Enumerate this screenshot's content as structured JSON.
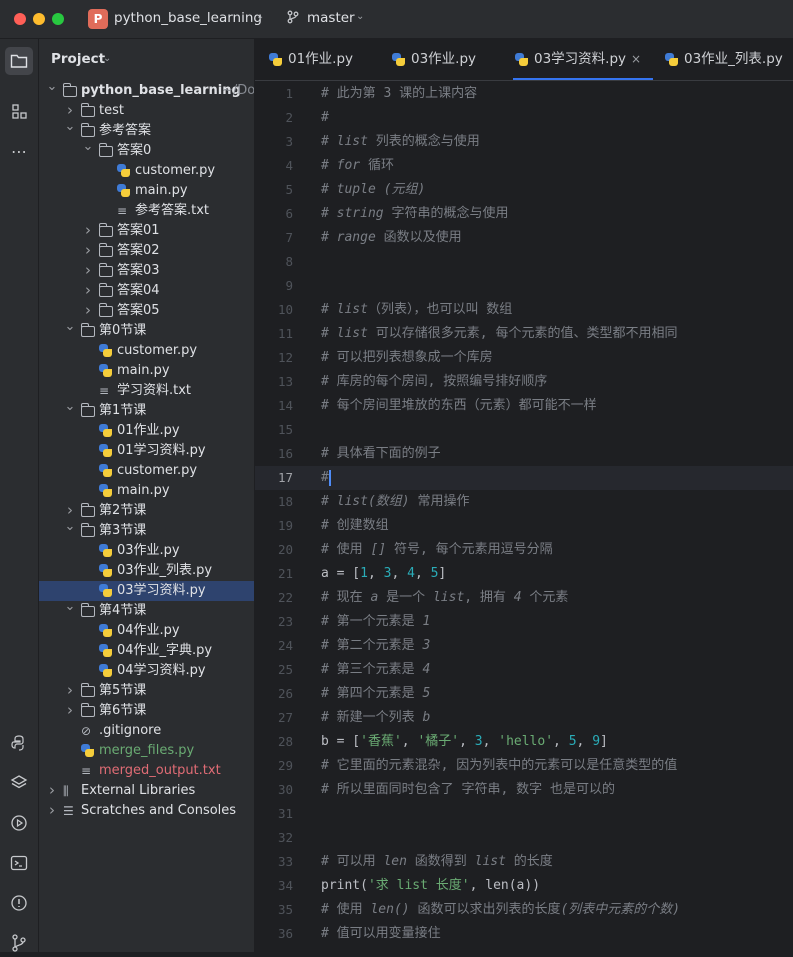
{
  "window": {
    "project_badge": "P",
    "project_name": "python_base_learning",
    "branch_name": "master"
  },
  "project_panel": {
    "title": "Project",
    "tree": [
      {
        "label": "python_base_learning",
        "suffix": " ~/Do",
        "type": "folder",
        "depth": 0,
        "expanded": true,
        "bold": true
      },
      {
        "label": "test",
        "type": "folder",
        "depth": 1,
        "expanded": false
      },
      {
        "label": "参考答案",
        "type": "folder",
        "depth": 1,
        "expanded": true
      },
      {
        "label": "答案0",
        "type": "folder",
        "depth": 2,
        "expanded": true
      },
      {
        "label": "customer.py",
        "type": "py",
        "depth": 3
      },
      {
        "label": "main.py",
        "type": "py",
        "depth": 3
      },
      {
        "label": "参考答案.txt",
        "type": "txt",
        "depth": 3
      },
      {
        "label": "答案01",
        "type": "folder",
        "depth": 2,
        "expanded": false
      },
      {
        "label": "答案02",
        "type": "folder",
        "depth": 2,
        "expanded": false
      },
      {
        "label": "答案03",
        "type": "folder",
        "depth": 2,
        "expanded": false
      },
      {
        "label": "答案04",
        "type": "folder",
        "depth": 2,
        "expanded": false
      },
      {
        "label": "答案05",
        "type": "folder",
        "depth": 2,
        "expanded": false
      },
      {
        "label": "第0节课",
        "type": "folder",
        "depth": 1,
        "expanded": true
      },
      {
        "label": "customer.py",
        "type": "py",
        "depth": 2
      },
      {
        "label": "main.py",
        "type": "py",
        "depth": 2
      },
      {
        "label": "学习资料.txt",
        "type": "txt",
        "depth": 2
      },
      {
        "label": "第1节课",
        "type": "folder",
        "depth": 1,
        "expanded": true
      },
      {
        "label": "01作业.py",
        "type": "py",
        "depth": 2
      },
      {
        "label": "01学习资料.py",
        "type": "py",
        "depth": 2
      },
      {
        "label": "customer.py",
        "type": "py",
        "depth": 2
      },
      {
        "label": "main.py",
        "type": "py",
        "depth": 2
      },
      {
        "label": "第2节课",
        "type": "folder",
        "depth": 1,
        "expanded": false
      },
      {
        "label": "第3节课",
        "type": "folder",
        "depth": 1,
        "expanded": true
      },
      {
        "label": "03作业.py",
        "type": "py",
        "depth": 2
      },
      {
        "label": "03作业_列表.py",
        "type": "py",
        "depth": 2
      },
      {
        "label": "03学习资料.py",
        "type": "py",
        "depth": 2,
        "selected": true
      },
      {
        "label": "第4节课",
        "type": "folder",
        "depth": 1,
        "expanded": true
      },
      {
        "label": "04作业.py",
        "type": "py",
        "depth": 2
      },
      {
        "label": "04作业_字典.py",
        "type": "py",
        "depth": 2
      },
      {
        "label": "04学习资料.py",
        "type": "py",
        "depth": 2
      },
      {
        "label": "第5节课",
        "type": "folder",
        "depth": 1,
        "expanded": false
      },
      {
        "label": "第6节课",
        "type": "folder",
        "depth": 1,
        "expanded": false
      },
      {
        "label": ".gitignore",
        "type": "git",
        "depth": 1
      },
      {
        "label": "merge_files.py",
        "type": "py",
        "depth": 1,
        "color": "green"
      },
      {
        "label": "merged_output.txt",
        "type": "txt",
        "depth": 1,
        "color": "red"
      },
      {
        "label": "External Libraries",
        "type": "lib",
        "depth": 0,
        "expanded": false
      },
      {
        "label": "Scratches and Consoles",
        "type": "scratch",
        "depth": 0,
        "expanded": false
      }
    ]
  },
  "tabs": [
    {
      "label": "01作业.py",
      "active": false
    },
    {
      "label": "03作业.py",
      "active": false
    },
    {
      "label": "03学习资料.py",
      "active": true,
      "close": "×"
    },
    {
      "label": "03作业_列表.py",
      "active": false
    }
  ],
  "editor": {
    "current_line": 17,
    "lines": [
      {
        "n": "1",
        "segs": [
          [
            "cm",
            "# 此为第 3 课的上课内容"
          ]
        ]
      },
      {
        "n": "2",
        "segs": [
          [
            "cm",
            "#"
          ]
        ]
      },
      {
        "n": "3",
        "segs": [
          [
            "cm",
            "# "
          ],
          [
            "cmi",
            "list"
          ],
          [
            "cm",
            " 列表的概念与使用"
          ]
        ]
      },
      {
        "n": "4",
        "segs": [
          [
            "cm",
            "# "
          ],
          [
            "cmi",
            "for"
          ],
          [
            "cm",
            " 循环"
          ]
        ]
      },
      {
        "n": "5",
        "segs": [
          [
            "cm",
            "# "
          ],
          [
            "cmi",
            "tuple (元组)"
          ]
        ]
      },
      {
        "n": "6",
        "segs": [
          [
            "cm",
            "# "
          ],
          [
            "cmi",
            "string"
          ],
          [
            "cm",
            " 字符串的概念与使用"
          ]
        ]
      },
      {
        "n": "7",
        "segs": [
          [
            "cm",
            "# "
          ],
          [
            "cmi",
            "range"
          ],
          [
            "cm",
            " 函数以及使用"
          ]
        ]
      },
      {
        "n": "8",
        "segs": []
      },
      {
        "n": "9",
        "segs": []
      },
      {
        "n": "10",
        "segs": [
          [
            "cm",
            "# "
          ],
          [
            "cmi",
            "list"
          ],
          [
            "cm",
            "（列表），也可以叫 数组"
          ]
        ]
      },
      {
        "n": "11",
        "segs": [
          [
            "cm",
            "# "
          ],
          [
            "cmi",
            "list"
          ],
          [
            "cm",
            " 可以存储很多元素, 每个元素的值、类型都不用相同"
          ]
        ]
      },
      {
        "n": "12",
        "segs": [
          [
            "cm",
            "# 可以把列表想象成一个库房"
          ]
        ]
      },
      {
        "n": "13",
        "segs": [
          [
            "cm",
            "# 库房的每个房间, 按照编号排好顺序"
          ]
        ]
      },
      {
        "n": "14",
        "segs": [
          [
            "cm",
            "# 每个房间里堆放的东西（元素）都可能不一样"
          ]
        ]
      },
      {
        "n": "15",
        "segs": []
      },
      {
        "n": "16",
        "segs": [
          [
            "cm",
            "# 具体看下面的例子"
          ]
        ]
      },
      {
        "n": "17",
        "segs": [
          [
            "cm",
            "#"
          ],
          [
            "caret",
            ""
          ]
        ]
      },
      {
        "n": "18",
        "segs": [
          [
            "cm",
            "# "
          ],
          [
            "cmi",
            "list(数组)"
          ],
          [
            "cm",
            " 常用操作"
          ]
        ]
      },
      {
        "n": "19",
        "segs": [
          [
            "cm",
            "# 创建数组"
          ]
        ]
      },
      {
        "n": "20",
        "segs": [
          [
            "cm",
            "# 使用 "
          ],
          [
            "cmi",
            "[]"
          ],
          [
            "cm",
            " 符号, 每个元素用逗号分隔"
          ]
        ]
      },
      {
        "n": "21",
        "segs": [
          [
            "txt",
            "a = ["
          ],
          [
            "num",
            "1"
          ],
          [
            "txt",
            ", "
          ],
          [
            "num",
            "3"
          ],
          [
            "txt",
            ", "
          ],
          [
            "num",
            "4"
          ],
          [
            "txt",
            ", "
          ],
          [
            "num",
            "5"
          ],
          [
            "txt",
            "]"
          ]
        ]
      },
      {
        "n": "22",
        "segs": [
          [
            "cm",
            "# 现在 "
          ],
          [
            "cmi",
            "a"
          ],
          [
            "cm",
            " 是一个 "
          ],
          [
            "cmi",
            "list"
          ],
          [
            "cm",
            ", 拥有 "
          ],
          [
            "cmi",
            "4"
          ],
          [
            "cm",
            " 个元素"
          ]
        ]
      },
      {
        "n": "23",
        "segs": [
          [
            "cm",
            "# 第一个元素是 "
          ],
          [
            "cmi",
            "1"
          ]
        ]
      },
      {
        "n": "24",
        "segs": [
          [
            "cm",
            "# 第二个元素是 "
          ],
          [
            "cmi",
            "3"
          ]
        ]
      },
      {
        "n": "25",
        "segs": [
          [
            "cm",
            "# 第三个元素是 "
          ],
          [
            "cmi",
            "4"
          ]
        ]
      },
      {
        "n": "26",
        "segs": [
          [
            "cm",
            "# 第四个元素是 "
          ],
          [
            "cmi",
            "5"
          ]
        ]
      },
      {
        "n": "27",
        "segs": [
          [
            "cm",
            "# 新建一个列表 "
          ],
          [
            "cmi",
            "b"
          ]
        ]
      },
      {
        "n": "28",
        "segs": [
          [
            "txt",
            "b = ["
          ],
          [
            "str",
            "'香蕉'"
          ],
          [
            "txt",
            ", "
          ],
          [
            "str",
            "'橘子'"
          ],
          [
            "txt",
            ", "
          ],
          [
            "num",
            "3"
          ],
          [
            "txt",
            ", "
          ],
          [
            "str",
            "'hello'"
          ],
          [
            "txt",
            ", "
          ],
          [
            "num",
            "5"
          ],
          [
            "txt",
            ", "
          ],
          [
            "num",
            "9"
          ],
          [
            "txt",
            "]"
          ]
        ]
      },
      {
        "n": "29",
        "segs": [
          [
            "cm",
            "# 它里面的元素混杂, 因为列表中的元素可以是任意类型的值"
          ]
        ]
      },
      {
        "n": "30",
        "segs": [
          [
            "cm",
            "# 所以里面同时包含了 字符串, 数字 也是可以的"
          ]
        ]
      },
      {
        "n": "31",
        "segs": []
      },
      {
        "n": "32",
        "segs": []
      },
      {
        "n": "33",
        "segs": [
          [
            "cm",
            "# 可以用 "
          ],
          [
            "cmi",
            "len"
          ],
          [
            "cm",
            " 函数得到 "
          ],
          [
            "cmi",
            "list"
          ],
          [
            "cm",
            " 的长度"
          ]
        ]
      },
      {
        "n": "34",
        "segs": [
          [
            "txt",
            "print("
          ],
          [
            "str",
            "'求 list 长度'"
          ],
          [
            "txt",
            ", len(a))"
          ]
        ]
      },
      {
        "n": "35",
        "segs": [
          [
            "cm",
            "# 使用 "
          ],
          [
            "cmi",
            "len()"
          ],
          [
            "cm",
            " 函数可以求出列表的长度"
          ],
          [
            "cmi",
            "(列表中元素的个数)"
          ]
        ]
      },
      {
        "n": "36",
        "segs": [
          [
            "cm",
            "# 值可以用变量接住"
          ]
        ]
      }
    ]
  },
  "tool_icons": [
    "folder-icon",
    "structure-icon",
    "more-icon",
    "python-console-icon",
    "layers-icon",
    "run-icon",
    "terminal-icon",
    "problems-icon",
    "git-icon"
  ]
}
